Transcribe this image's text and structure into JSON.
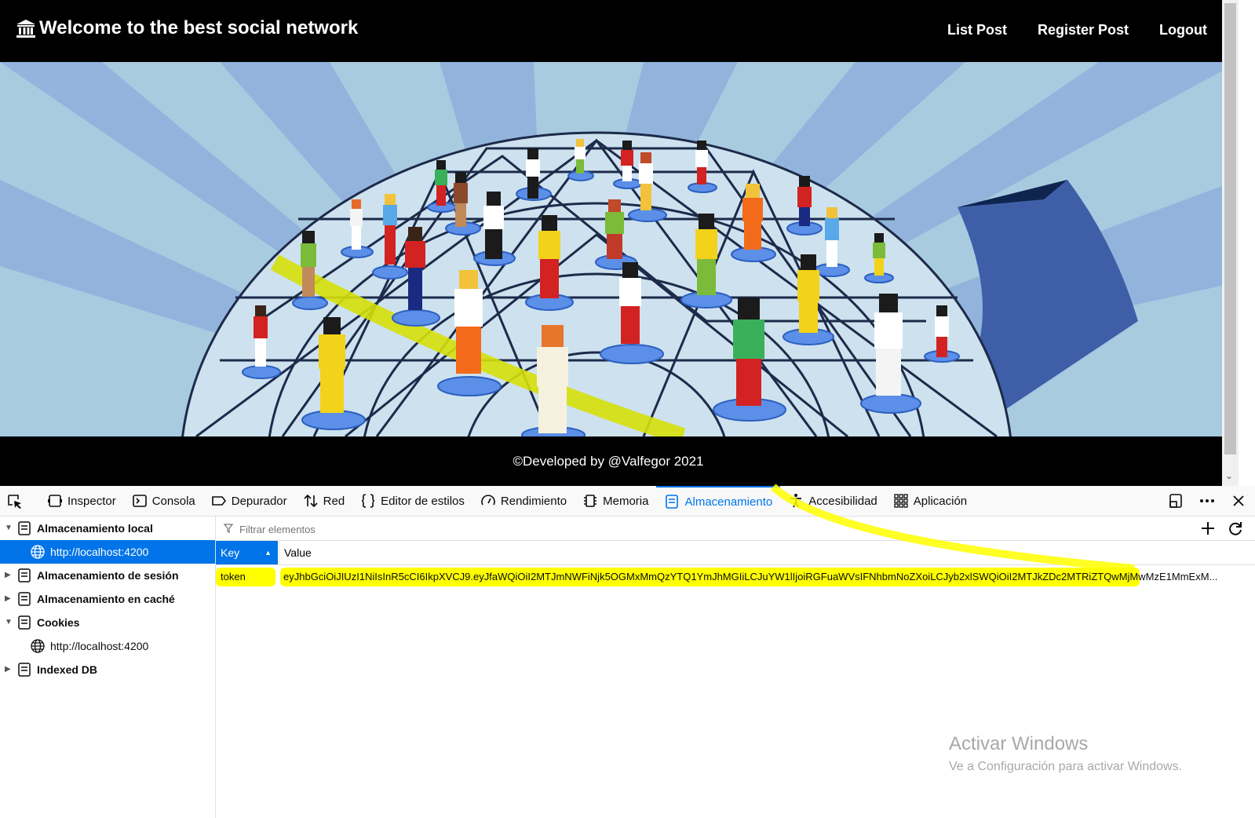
{
  "navbar": {
    "brand": "Welcome to the best social network",
    "brand_icon": "bank-icon",
    "links": [
      "List Post",
      "Register Post",
      "Logout"
    ]
  },
  "footer": {
    "text": "©Developed by @Valfegor 2021"
  },
  "devtools": {
    "tabs": [
      {
        "label": "Inspector",
        "icon": "inspector-icon"
      },
      {
        "label": "Consola",
        "icon": "console-icon"
      },
      {
        "label": "Depurador",
        "icon": "debugger-icon"
      },
      {
        "label": "Red",
        "icon": "network-icon"
      },
      {
        "label": "Editor de estilos",
        "icon": "style-editor-icon"
      },
      {
        "label": "Rendimiento",
        "icon": "performance-icon"
      },
      {
        "label": "Memoria",
        "icon": "memory-icon"
      },
      {
        "label": "Almacenamiento",
        "icon": "storage-icon"
      },
      {
        "label": "Accesibilidad",
        "icon": "accessibility-icon"
      },
      {
        "label": "Aplicación",
        "icon": "application-icon"
      }
    ],
    "active_tab": "Almacenamiento",
    "accent_color": "#0074e8",
    "sidebar": {
      "local_storage": "Almacenamiento local",
      "local_storage_host": "http://localhost:4200",
      "session_storage": "Almacenamiento de sesión",
      "cache_storage": "Almacenamiento en caché",
      "cookies": "Cookies",
      "cookies_host": "http://localhost:4200",
      "indexed_db": "Indexed DB"
    },
    "filter_placeholder": "Filtrar elementos",
    "table": {
      "col_key": "Key",
      "col_value": "Value",
      "rows": [
        {
          "key": "token",
          "value": "eyJhbGciOiJIUzI1NiIsInR5cCI6IkpXVCJ9.eyJfaWQiOiI2MTJmNWFiNjk5OGMxMmQzYTQ1YmJhMGIiLCJuYW1lIjoiRGFuaWVsIFNhbmNoZXoiLCJyb2xlSWQiOiI2MTJkZDc2MTRiZTQwMjMwMzE1MmExM..."
        }
      ]
    }
  },
  "watermark": {
    "title": "Activar Windows",
    "subtitle": "Ve a Configuración para activar Windows."
  }
}
